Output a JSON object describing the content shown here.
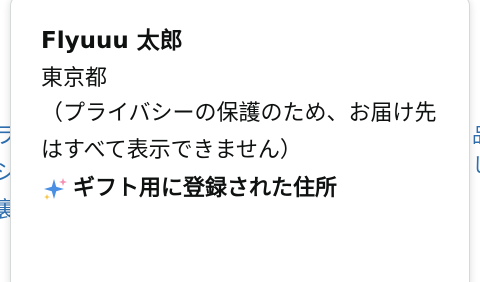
{
  "popover": {
    "name": "Flyuuu 太郎",
    "prefecture": "東京都",
    "privacy_notice": "（プライバシーの保護のため、お届け先はすべて表示できません）",
    "gift_label": "ギフト用に登録された住所",
    "gift_icon": "sparkle-icon"
  },
  "background": {
    "left_fragments": [
      "ラ",
      "シ",
      "裏"
    ],
    "right_fragments": [
      "品",
      "し"
    ]
  },
  "colors": {
    "text": "#0f1111",
    "border": "#d5d9d9",
    "background_link": "#2f6fb0",
    "sparkle_blue": "#4a90e2",
    "sparkle_pink": "#f48fb1",
    "sparkle_yellow": "#f5c542"
  }
}
